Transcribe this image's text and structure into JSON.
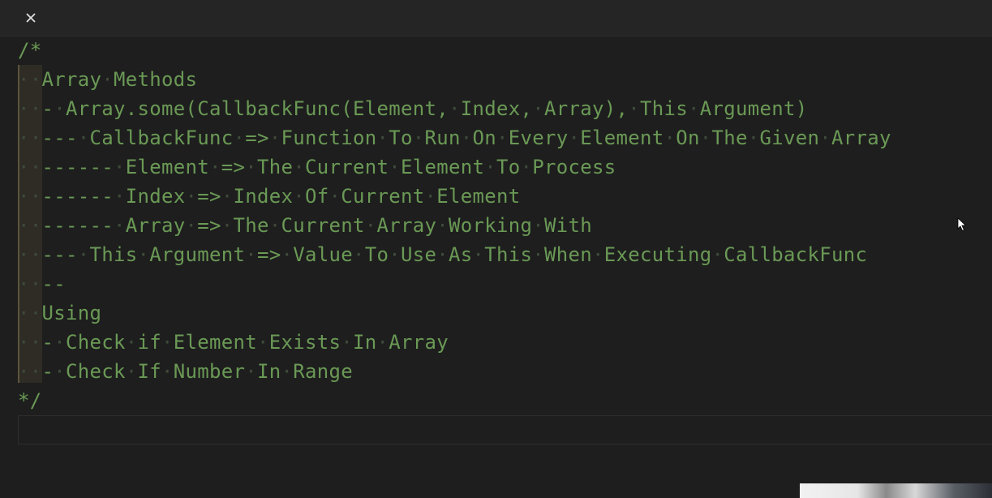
{
  "editor": {
    "comment_open": "/*",
    "comment_close": "*/",
    "lines": [
      "  Array Methods",
      "  - Array.some(CallbackFunc(Element, Index, Array), This Argument)",
      "  --- CallbackFunc => Function To Run On Every Element On The Given Array",
      "  ------ Element => The Current Element To Process",
      "  ------ Index => Index Of Current Element",
      "  ------ Array => The Current Array Working With",
      "  --- This Argument => Value To Use As This When Executing CallbackFunc",
      "  --",
      "  Using",
      "  - Check if Element Exists In Array",
      "  - Check If Number In Range"
    ]
  },
  "icons": {
    "close": "close-icon",
    "cursor": "mouse-pointer-icon"
  },
  "colors": {
    "background": "#1e1e1e",
    "comment": "#6a9955",
    "whitespace_dot": "#3f4a3a"
  }
}
